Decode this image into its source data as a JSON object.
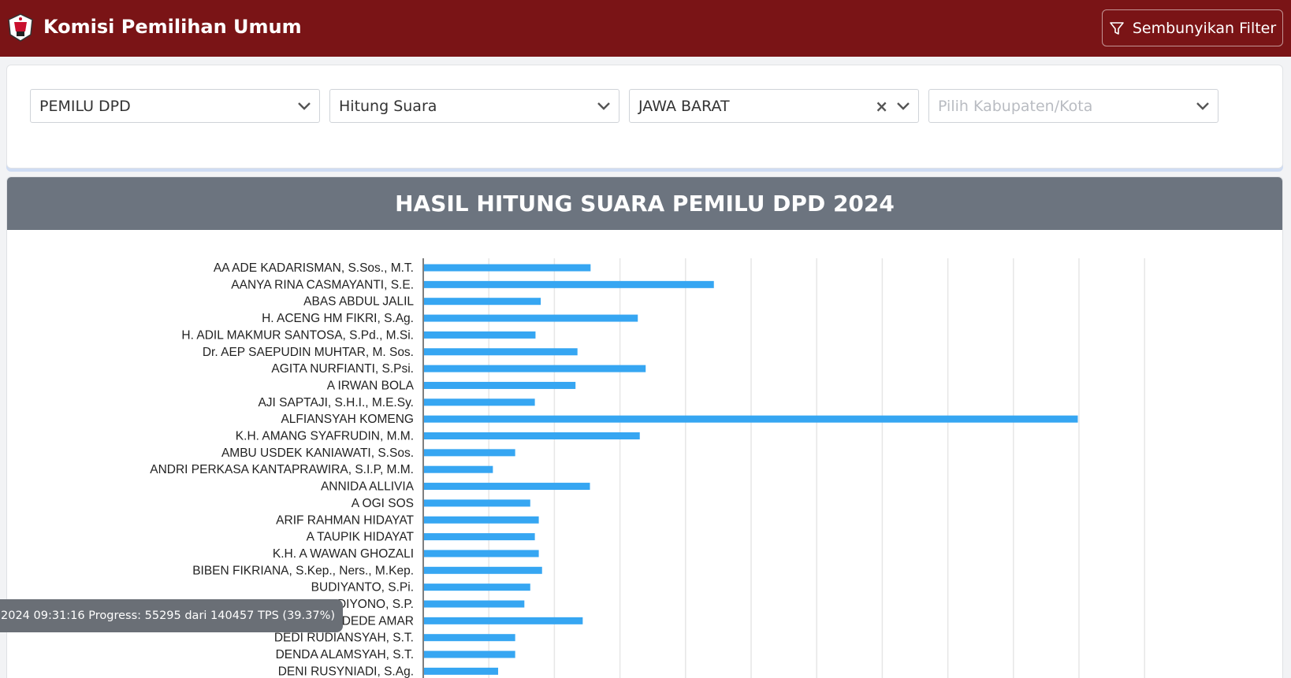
{
  "header": {
    "title": "Komisi Pemilihan Umum",
    "filter_button": "Sembunyikan Filter",
    "logo_icon": "kpu-logo-icon",
    "filter_icon": "filter-icon"
  },
  "filters": {
    "election": "PEMILU DPD",
    "mode": "Hitung Suara",
    "province": "JAWA BARAT",
    "regency_placeholder": "Pilih Kabupaten/Kota"
  },
  "chart_title": "HASIL HITUNG SUARA PEMILU DPD 2024",
  "progress_text": "2024 09:31:16 Progress: 55295 dari 140457 TPS (39.37%)",
  "colors": {
    "navbar": "#7a1416",
    "bar": "#36a6f2",
    "chart_header": "#6c747f"
  },
  "chart_data": {
    "type": "bar",
    "orientation": "horizontal",
    "title": "HASIL HITUNG SUARA PEMILU DPD 2024",
    "xlabel": "",
    "ylabel": "",
    "xlim": [
      0,
      11
    ],
    "grid": true,
    "categories": [
      "AA ADE KADARISMAN, S.Sos., M.T.",
      "AANYA RINA CASMAYANTI, S.E.",
      "ABAS ABDUL JALIL",
      "H. ACENG HM FIKRI, S.Ag.",
      "H. ADIL MAKMUR SANTOSA, S.Pd., M.Si.",
      "Dr. AEP SAEPUDIN MUHTAR, M. Sos.",
      "AGITA NURFIANTI, S.Psi.",
      "A IRWAN BOLA",
      "AJI SAPTAJI, S.H.I., M.E.Sy.",
      "ALFIANSYAH KOMENG",
      "K.H. AMANG SYAFRUDIN, M.M.",
      "AMBU USDEK KANIAWATI, S.Sos.",
      "ANDRI PERKASA KANTAPRAWIRA, S.I.P, M.M.",
      "ANNIDA ALLIVIA",
      "A OGI SOS",
      "ARIF RAHMAN HIDAYAT",
      "A TAUPIK HIDAYAT",
      "K.H. A WAWAN GHOZALI",
      "BIBEN FIKRIANA, S.Kep., Ners., M.Kep.",
      "BUDIYANTO, S.Pi.",
      "BUDIYONO, S.P.",
      "DEDE AMAR",
      "DEDI RUDIANSYAH, S.T.",
      "DENDA ALAMSYAH, S.T.",
      "DENI RUSYNIADI, S.Ag."
    ],
    "values": [
      2.54,
      4.42,
      1.78,
      3.26,
      1.7,
      2.34,
      3.38,
      2.31,
      1.69,
      9.97,
      3.29,
      1.39,
      1.05,
      2.53,
      1.62,
      1.75,
      1.69,
      1.75,
      1.8,
      1.62,
      1.53,
      2.42,
      1.39,
      1.39,
      1.13
    ]
  }
}
